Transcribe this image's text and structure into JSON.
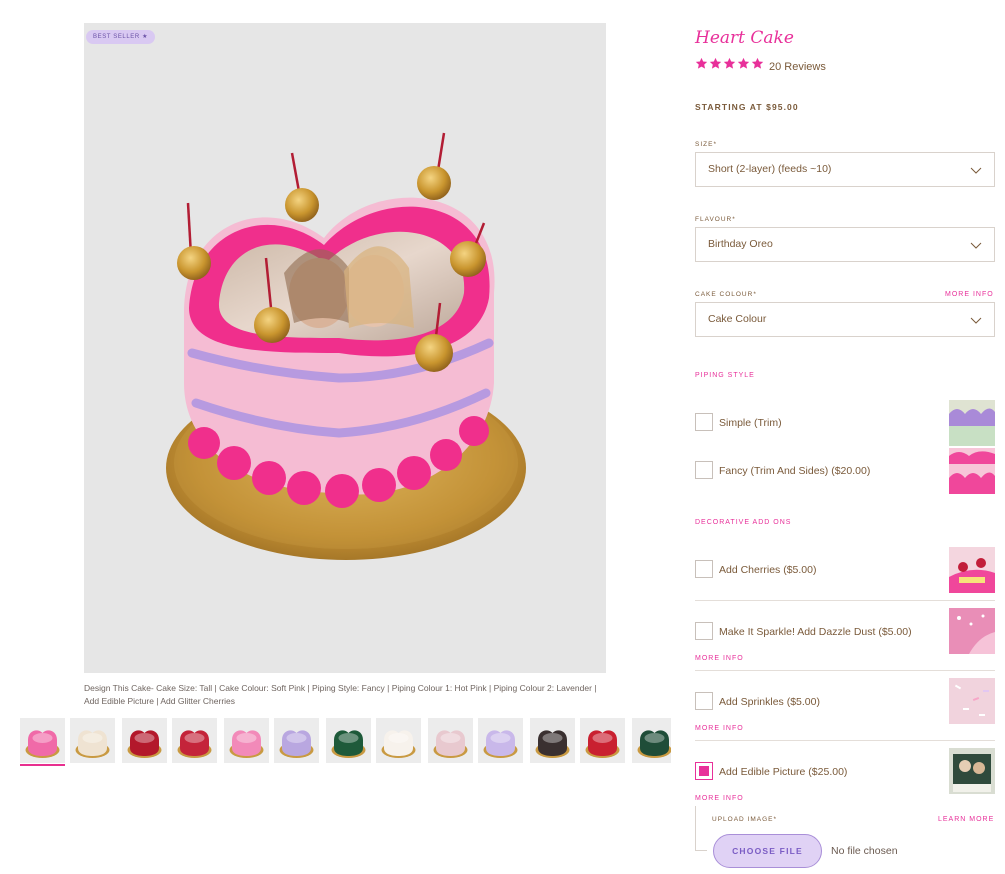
{
  "gallery": {
    "badge": "BEST SELLER ★",
    "caption": "Design This Cake- Cake Size: Tall | Cake Colour: Soft Pink | Piping Style: Fancy | Piping Colour 1: Hot Pink | Piping Colour 2: Lavender | Add Edible Picture | Add Glitter Cherries",
    "thumbnails": [
      {
        "name": "thumb-pink-heart-cake",
        "tone": "#f06aa8"
      },
      {
        "name": "thumb-cream-cake",
        "tone": "#efe3d2"
      },
      {
        "name": "thumb-red-cake",
        "tone": "#b3182b"
      },
      {
        "name": "thumb-red-heart-cake",
        "tone": "#c4243a"
      },
      {
        "name": "thumb-pink-cake",
        "tone": "#f28ab9"
      },
      {
        "name": "thumb-lavender-cake",
        "tone": "#b9a7e0"
      },
      {
        "name": "thumb-green-cake",
        "tone": "#1e5a3a"
      },
      {
        "name": "thumb-colour-swatches",
        "tone": "#f7f2ec"
      },
      {
        "name": "thumb-mint-pink-cake",
        "tone": "#e8c9cf"
      },
      {
        "name": "thumb-purple-white-cake",
        "tone": "#c9b8ea"
      },
      {
        "name": "thumb-black-white-cake",
        "tone": "#3a3030"
      },
      {
        "name": "thumb-red-cherry-cake",
        "tone": "#c92030"
      },
      {
        "name": "thumb-dark-green-cake",
        "tone": "#1f4d38"
      }
    ]
  },
  "product": {
    "title": "Heart Cake",
    "rating": 5,
    "reviews": "20 Reviews",
    "price": "STARTING AT $95.00",
    "accent": "#e8309a"
  },
  "form": {
    "size": {
      "label": "SIZE*",
      "value": "Short (2-layer) (feeds ~10)"
    },
    "flavour": {
      "label": "FLAVOUR*",
      "value": "Birthday Oreo"
    },
    "colour": {
      "label": "CAKE COLOUR*",
      "value": "Cake Colour",
      "more": "MORE INFO"
    },
    "piping": {
      "title": "PIPING STYLE",
      "options": [
        {
          "label": "Simple (Trim)",
          "checked": false
        },
        {
          "label": "Fancy (Trim And Sides) ($20.00)",
          "checked": false
        }
      ]
    },
    "addons": {
      "title": "DECORATIVE ADD ONS",
      "options": [
        {
          "label": "Add Cherries ($5.00)",
          "checked": false,
          "more": ""
        },
        {
          "label": "Make It Sparkle! Add Dazzle Dust ($5.00)",
          "checked": false,
          "more": "MORE INFO"
        },
        {
          "label": "Add Sprinkles ($5.00)",
          "checked": false,
          "more": "MORE INFO"
        },
        {
          "label": "Add Edible Picture ($25.00)",
          "checked": true,
          "more": "MORE INFO"
        }
      ]
    },
    "upload": {
      "label": "UPLOAD IMAGE*",
      "learn": "LEARN MORE",
      "button": "CHOOSE FILE",
      "status": "No file chosen"
    }
  }
}
